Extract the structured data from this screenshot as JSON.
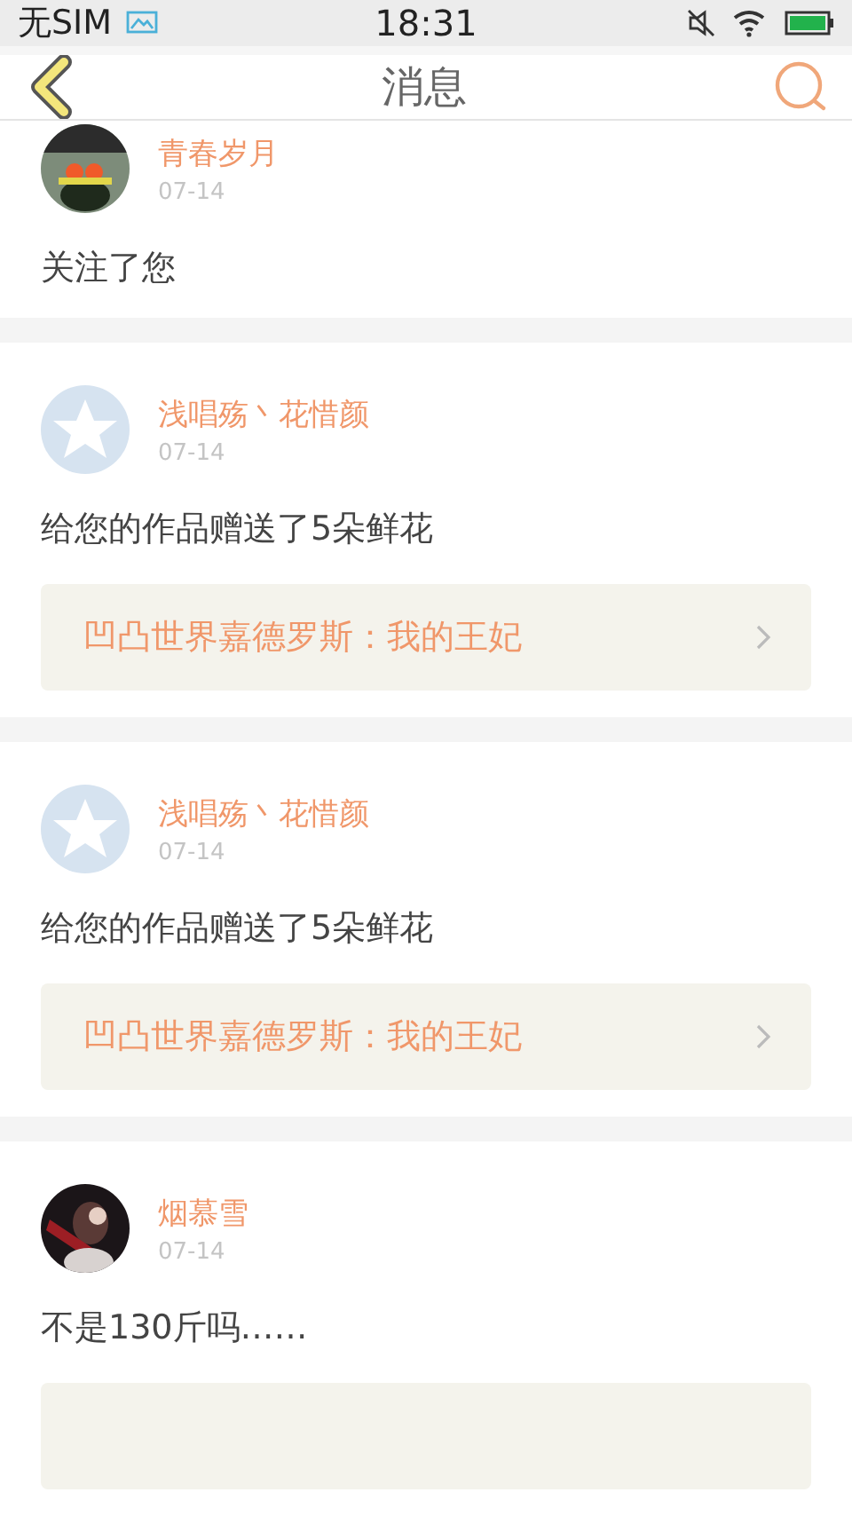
{
  "status_bar": {
    "carrier": "无SIM",
    "time": "18:31"
  },
  "header": {
    "title": "消息"
  },
  "messages": [
    {
      "kind": "follow",
      "name": "青春岁月",
      "date": "07-14",
      "text": "关注了您"
    },
    {
      "kind": "gift",
      "avatar": {
        "kind": "default"
      },
      "name": "浅唱殇丶花惜颜",
      "date": "07-14",
      "text": "给您的作品赠送了5朵鲜花",
      "link": "凹凸世界嘉德罗斯：我的王妃"
    },
    {
      "kind": "gift",
      "avatar": {
        "kind": "default"
      },
      "name": "浅唱殇丶花惜颜",
      "date": "07-14",
      "text": "给您的作品赠送了5朵鲜花",
      "link": "凹凸世界嘉德罗斯：我的王妃"
    },
    {
      "kind": "reply",
      "name": "烟慕雪",
      "date": "07-14",
      "text": "不是130斤吗……"
    }
  ]
}
